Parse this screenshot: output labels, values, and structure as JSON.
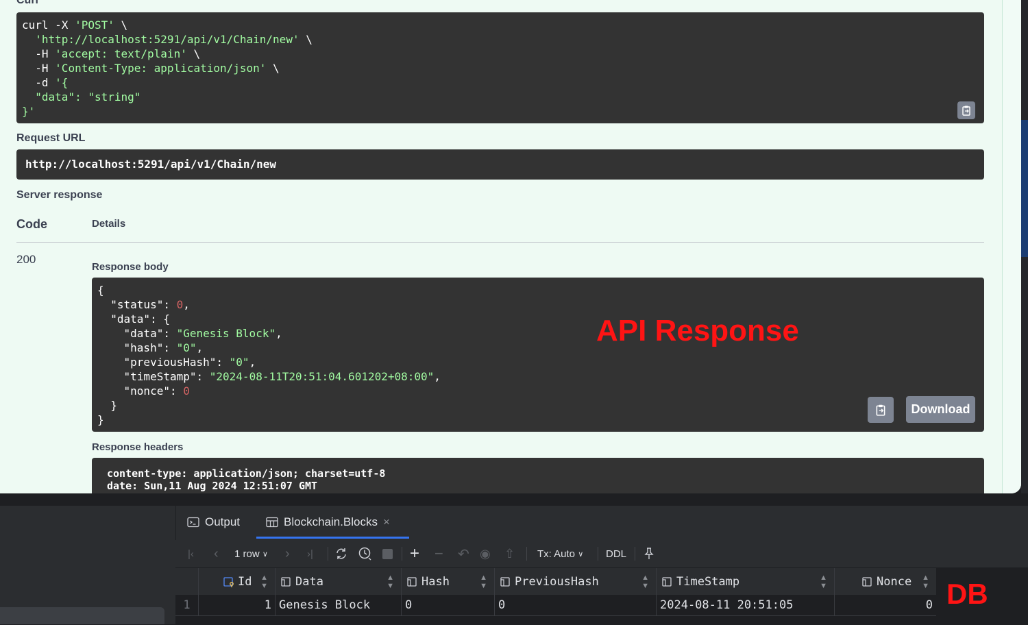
{
  "swagger": {
    "curl_label": "Curl",
    "curl_lines": [
      {
        "pre": "curl -X ",
        "str": "'POST'",
        "post": " \\"
      },
      {
        "pre": "  ",
        "str": "'http://localhost:5291/api/v1/Chain/new'",
        "post": " \\"
      },
      {
        "pre": "  -H ",
        "str": "'accept: text/plain'",
        "post": " \\"
      },
      {
        "pre": "  -H ",
        "str": "'Content-Type: application/json'",
        "post": " \\"
      },
      {
        "pre": "  -d ",
        "str": "'{",
        "post": ""
      },
      {
        "pre": "  ",
        "str": "\"data\": \"string\"",
        "post": ""
      },
      {
        "pre": "",
        "str": "}'",
        "post": ""
      }
    ],
    "request_url_label": "Request URL",
    "request_url": "http://localhost:5291/api/v1/Chain/new",
    "server_response_label": "Server response",
    "code_header": "Code",
    "details_header": "Details",
    "status_code": "200",
    "response_body_label": "Response body",
    "response_body": {
      "status_key": "\"status\"",
      "status_val": "0",
      "data_key": "\"data\"",
      "data_data_key": "\"data\"",
      "data_data_val": "\"Genesis Block\"",
      "hash_key": "\"hash\"",
      "hash_val": "\"0\"",
      "prev_key": "\"previousHash\"",
      "prev_val": "\"0\"",
      "ts_key": "\"timeStamp\"",
      "ts_val": "\"2024-08-11T20:51:04.601202+08:00\"",
      "nonce_key": "\"nonce\"",
      "nonce_val": "0"
    },
    "download_label": "Download",
    "response_headers_label": "Response headers",
    "response_headers": [
      "content-type: application/json; charset=utf-8",
      "date: Sun,11 Aug 2024 12:51:07 GMT"
    ],
    "annotation": "API Response"
  },
  "ide": {
    "tabs": [
      {
        "label": "Output"
      },
      {
        "label": "Blockchain.Blocks"
      }
    ],
    "close_glyph": "×",
    "toolbar": {
      "rows_label": "1 row",
      "tx_label": "Tx: Auto",
      "ddl_label": "DDL"
    },
    "columns": [
      "Id",
      "Data",
      "Hash",
      "PreviousHash",
      "TimeStamp",
      "Nonce"
    ],
    "rows": [
      {
        "num": "1",
        "id": "1",
        "data": "Genesis Block",
        "hash": "0",
        "prev": "0",
        "ts": "2024-08-11 20:51:05",
        "nonce": "0"
      }
    ],
    "annotation": "DB"
  }
}
